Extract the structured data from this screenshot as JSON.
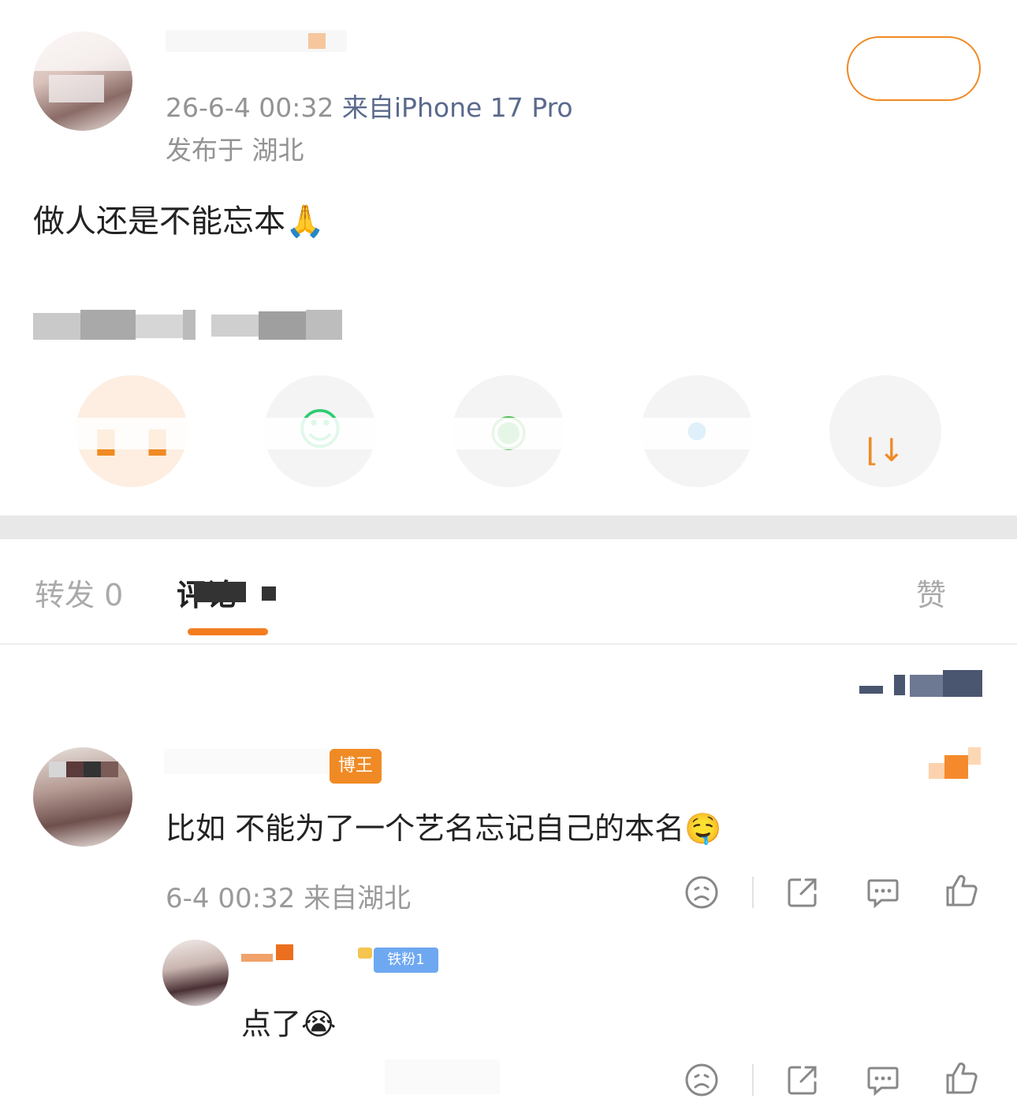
{
  "post": {
    "timestamp": "26-6-4 00:32",
    "source": "来自iPhone 17 Pro",
    "location": "发布于 湖北",
    "text": "做人还是不能忘本🙏"
  },
  "tabs": {
    "repost": "转发 0",
    "comment": "评论",
    "like": "赞"
  },
  "comment": {
    "badge": "博王",
    "text": "比如 不能为了一个艺名忘记自己的本名🤤",
    "meta": "6-4 00:32  来自湖北"
  },
  "reply": {
    "badge": "铁粉1",
    "text": "点了😭"
  },
  "icons": {
    "like": "thumb-up-icon",
    "comment": "comment-bubble-icon",
    "share": "share-icon",
    "dislike": "frown-face-icon"
  },
  "colors": {
    "accent": "#f47d1f",
    "source_link": "#5a6a8d",
    "secondary_text": "#939393"
  }
}
